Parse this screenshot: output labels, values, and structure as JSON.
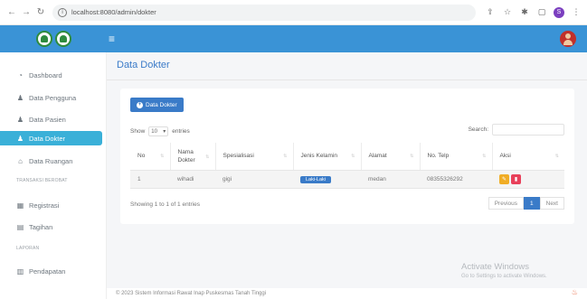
{
  "browser": {
    "url": "localhost:8080/admin/dokter",
    "profile_initial": "S"
  },
  "header": {
    "menu_icon": "hamburger-icon"
  },
  "sidebar": {
    "items": [
      {
        "label": "Dashboard",
        "icon": "dashboard-icon"
      },
      {
        "label": "Data Pengguna",
        "icon": "user-icon"
      },
      {
        "label": "Data Pasien",
        "icon": "user-icon"
      },
      {
        "label": "Data Dokter",
        "icon": "user-icon",
        "active": true
      },
      {
        "label": "Data Ruangan",
        "icon": "home-icon"
      },
      {
        "label": "Registrasi",
        "icon": "calendar-icon"
      },
      {
        "label": "Tagihan",
        "icon": "invoice-icon"
      },
      {
        "label": "Pendapatan",
        "icon": "chart-icon"
      }
    ],
    "section_transaksi": "TRANSAKSI BEROBAT",
    "section_laporan": "LAPORAN"
  },
  "main": {
    "title": "Data Dokter",
    "add_button": "Data Dokter",
    "show_label": "Show",
    "entries_value": "10",
    "entries_label": "entries",
    "search_label": "Search:",
    "table": {
      "headers": [
        "No",
        "Nama Dokter",
        "Spesialisasi",
        "Jenis Kelamin",
        "Alamat",
        "No. Telp",
        "Aksi"
      ],
      "rows": [
        {
          "no": "1",
          "nama": "wihadi",
          "spesialisasi": "gigi",
          "jenis_kelamin": "Laki-Laki",
          "alamat": "medan",
          "telp": "08355326292"
        }
      ]
    },
    "showing": "Showing 1 to 1 of 1 entries",
    "pager": {
      "prev": "Previous",
      "current": "1",
      "next": "Next"
    }
  },
  "watermark": {
    "line1": "Activate Windows",
    "line2": "Go to Settings to activate Windows."
  },
  "footer": "© 2023 Sistem Informasi Rawat Inap Puskesmas Tanah Tinggi",
  "colors": {
    "header_bg": "#3a93d6",
    "active_item": "#3ab0d8",
    "primary": "#3a7bc8",
    "edit": "#f0ad26",
    "delete": "#e8405a"
  }
}
